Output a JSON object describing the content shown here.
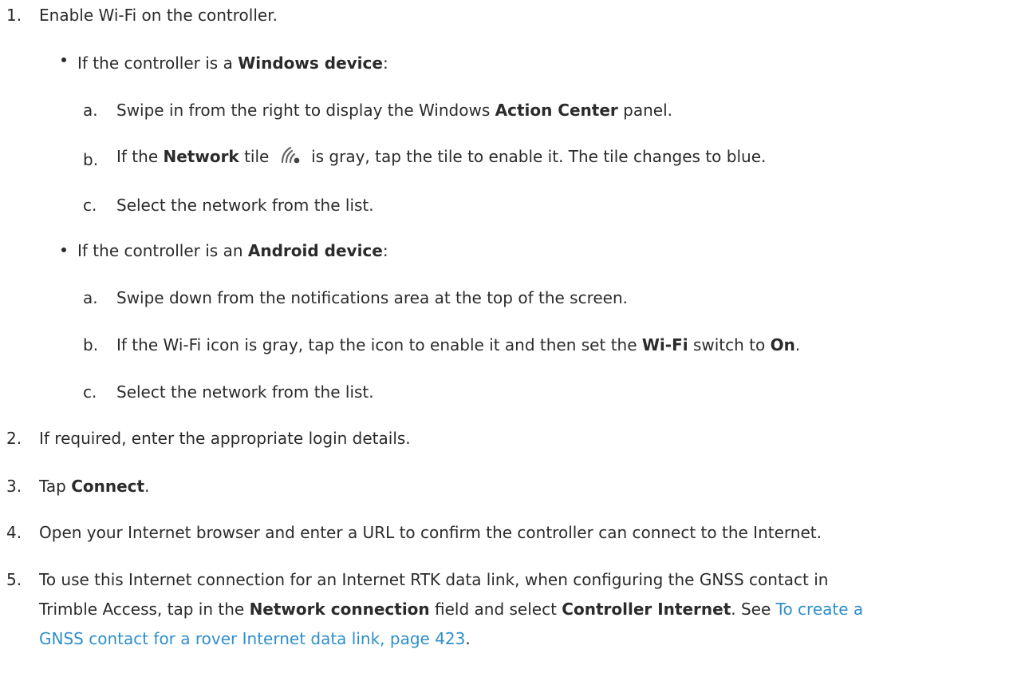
{
  "steps": [
    {
      "num": "1.",
      "text": "Enable Wi-Fi on the controller.",
      "bullets": [
        {
          "pre": "If the controller is a ",
          "bold": "Windows device",
          "post": ":",
          "sub": [
            {
              "letter": "a.",
              "pre": "Swipe in from the right to display the Windows ",
              "bold": "Action Center",
              "post": " panel."
            },
            {
              "letter": "b.",
              "pre": "If the ",
              "bold": "Network",
              "mid": " tile ",
              "icon": "network-tile-icon",
              "post": " is gray, tap the tile to enable it. The tile changes to blue."
            },
            {
              "letter": "c.",
              "text": "Select the network from the list."
            }
          ]
        },
        {
          "pre": "If the controller is an ",
          "bold": "Android device",
          "post": ":",
          "sub": [
            {
              "letter": "a.",
              "text": "Swipe down from the notifications area at the top of the screen."
            },
            {
              "letter": "b.",
              "pre": "If the Wi-Fi icon is gray, tap the icon to enable it and then set the ",
              "bold": "Wi-Fi",
              "mid": " switch to ",
              "bold2": "On",
              "post": "."
            },
            {
              "letter": "c.",
              "text": "Select the network from the list."
            }
          ]
        }
      ]
    },
    {
      "num": "2.",
      "text": "If required, enter the appropriate login details."
    },
    {
      "num": "3.",
      "pre": "Tap ",
      "bold": "Connect",
      "post": "."
    },
    {
      "num": "4.",
      "text": "Open your Internet browser and enter a URL to confirm the controller can connect to the Internet."
    },
    {
      "num": "5.",
      "line1": "To use this Internet connection for an Internet RTK data link, when configuring the GNSS contact in",
      "line2_pre": "Trimble Access, tap in the ",
      "line2_bold1": "Network connection",
      "line2_mid": " field and select ",
      "line2_bold2": "Controller Internet",
      "line2_post": ". See ",
      "link_part1": "To create a",
      "link_part2": "GNSS contact for a rover Internet data link, page 423",
      "line3_post": "."
    }
  ],
  "colors": {
    "text": "#2b2b2b",
    "link": "#2f8fc9",
    "icon": "#666666"
  }
}
